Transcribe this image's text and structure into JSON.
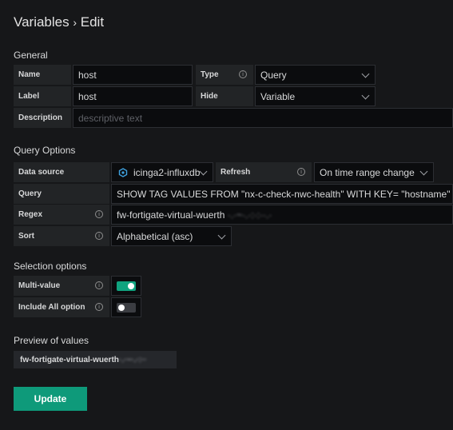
{
  "header": {
    "title_main": "Variables",
    "title_sep": "›",
    "title_page": "Edit"
  },
  "general": {
    "heading": "General",
    "name_label": "Name",
    "name_value": "host",
    "type_label": "Type",
    "type_value": "Query",
    "label_label": "Label",
    "label_value": "host",
    "hide_label": "Hide",
    "hide_value": "Variable",
    "description_label": "Description",
    "description_placeholder": "descriptive text"
  },
  "query_options": {
    "heading": "Query Options",
    "datasource_label": "Data source",
    "datasource_value": "icinga2-influxdb",
    "refresh_label": "Refresh",
    "refresh_value": "On time range change",
    "query_label": "Query",
    "query_value": "SHOW TAG VALUES FROM \"nx-c-check-nwc-health\" WITH KEY= \"hostname\"",
    "regex_label": "Regex",
    "regex_value": "fw-fortigate-virtual-wuerth",
    "sort_label": "Sort",
    "sort_value": "Alphabetical (asc)"
  },
  "selection_options": {
    "heading": "Selection options",
    "multivalue_label": "Multi-value",
    "multivalue_on": true,
    "includeall_label": "Include All option",
    "includeall_on": false
  },
  "preview": {
    "heading": "Preview of values",
    "value": "fw-fortigate-virtual-wuerth"
  },
  "actions": {
    "update_label": "Update"
  },
  "colors": {
    "accent": "#10a37f",
    "button": "#0e9a7a",
    "background": "#161719"
  }
}
